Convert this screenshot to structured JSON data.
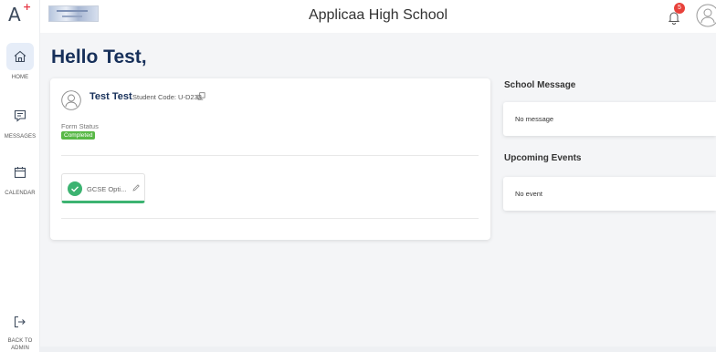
{
  "app": {
    "school_name": "Applicaa High School",
    "notification_count": "5"
  },
  "sidebar": {
    "items": [
      {
        "label": "HOME",
        "icon": "home-icon",
        "active": true
      },
      {
        "label": "MESSAGES",
        "icon": "message-icon",
        "active": false
      },
      {
        "label": "CALENDAR",
        "icon": "calendar-icon",
        "active": false
      }
    ],
    "back_label_line1": "BACK TO",
    "back_label_line2": "ADMIN"
  },
  "main": {
    "greeting": "Hello Test,",
    "student": {
      "name": "Test Test",
      "code_label": "Student Code: U-D233"
    },
    "form_status": {
      "label": "Form Status",
      "value": "Completed"
    },
    "forms": [
      {
        "title": "GCSE Opti..."
      }
    ]
  },
  "school_message": {
    "title": "School Message",
    "text": "No message"
  },
  "upcoming_events": {
    "title": "Upcoming Events",
    "text": "No event"
  },
  "colors": {
    "accent": "#17305a",
    "success": "#58b846",
    "badge": "#e8413a"
  }
}
